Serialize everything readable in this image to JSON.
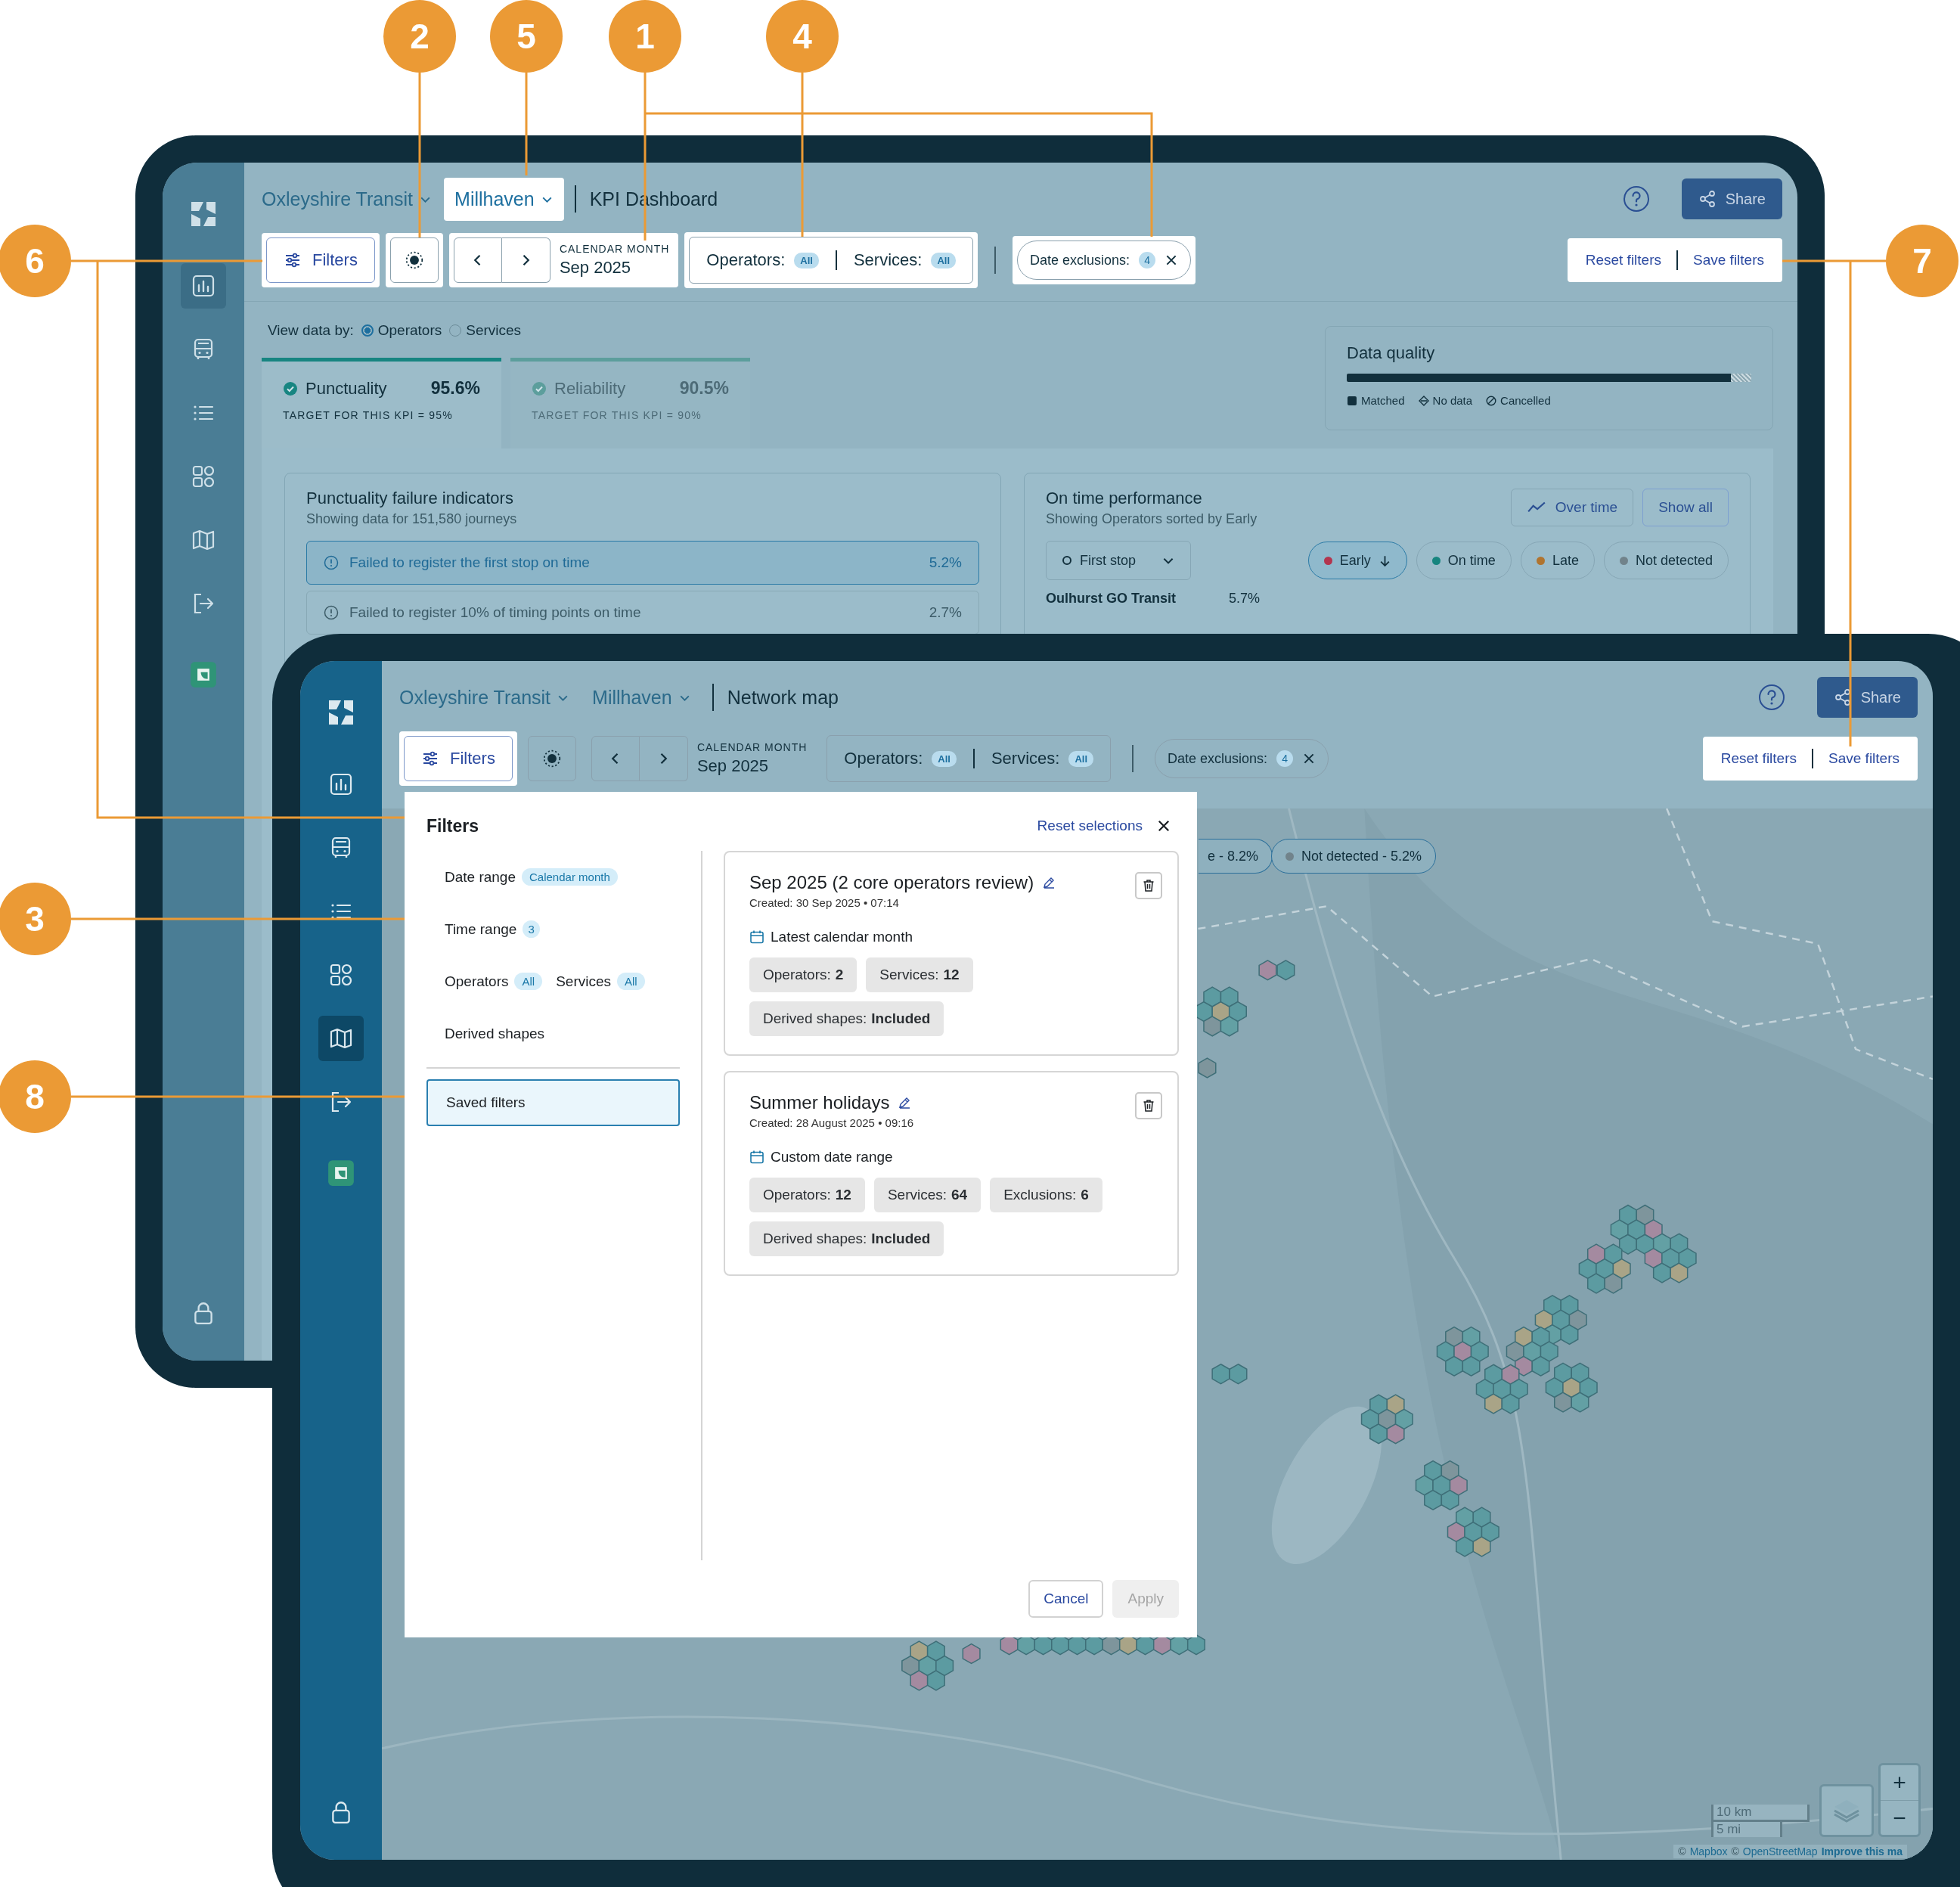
{
  "callouts": [
    {
      "number": "2"
    },
    {
      "number": "5"
    },
    {
      "number": "1"
    },
    {
      "number": "4"
    },
    {
      "number": "6"
    },
    {
      "number": "7"
    },
    {
      "number": "3"
    },
    {
      "number": "8"
    }
  ],
  "kpi_dashboard": {
    "sidebar": [
      {
        "kind": "chart",
        "selected": true
      },
      {
        "kind": "bus",
        "selected": false
      },
      {
        "kind": "list",
        "selected": false
      },
      {
        "kind": "apps",
        "selected": false
      },
      {
        "kind": "map",
        "selected": false
      },
      {
        "kind": "exit",
        "selected": false
      },
      {
        "kind": "tile",
        "selected": false
      }
    ],
    "breadcrumb": {
      "organisation": "Oxleyshire Transit",
      "area": {
        "label": "Millhaven",
        "highlighted": true
      },
      "page": "KPI Dashboard"
    },
    "share": "Share",
    "toolbar": {
      "filters": {
        "label": "Filters",
        "highlighted": true
      },
      "theme": {
        "highlighted": true
      },
      "period": {
        "label": "CALENDAR MONTH",
        "value": "Sep 2025",
        "highlighted": true
      },
      "scope": {
        "operators_label": "Operators:",
        "operators_badge": "All",
        "services_label": "Services:",
        "services_badge": "All",
        "highlighted": true
      },
      "exclusions": {
        "label": "Date exclusions:",
        "count": "4",
        "highlighted": true
      },
      "saved": {
        "reset": "Reset filters",
        "save": "Save filters",
        "highlighted": true
      }
    },
    "view_by": {
      "label": "View data by:",
      "options": [
        {
          "label": "Operators",
          "selected": true
        },
        {
          "label": "Services",
          "selected": false
        }
      ]
    },
    "kpi_tabs": [
      {
        "label": "Punctuality",
        "value": "95.6%",
        "target": "TARGET FOR THIS KPI = 95%",
        "selected": true
      },
      {
        "label": "Reliability",
        "value": "90.5%",
        "target": "TARGET FOR THIS KPI = 90%",
        "selected": false
      }
    ],
    "data_quality": {
      "title": "Data quality",
      "level": 0.95,
      "legend": [
        {
          "kind": "matched",
          "label": "Matched"
        },
        {
          "kind": "no_data",
          "label": "No data"
        },
        {
          "kind": "cancelled",
          "label": "Cancelled"
        }
      ]
    },
    "failure_indicators": {
      "title": "Punctuality failure indicators",
      "subtitle": "Showing data for 151,580 journeys",
      "rows": [
        {
          "label": "Failed to register the first stop on time",
          "value": "5.2%",
          "selected": true
        },
        {
          "label": "Failed to register 10% of timing points on time",
          "value": "2.7%",
          "selected": false
        }
      ]
    },
    "on_time_performance": {
      "title": "On time performance",
      "subtitle": "Showing Operators sorted by Early",
      "buttons": [
        {
          "kind": "trend",
          "label": "Over time"
        },
        {
          "kind": "plain",
          "label": "Show all"
        }
      ],
      "stop_select": "First stop",
      "categories": [
        {
          "label": "Early",
          "color": "#b3354e",
          "selected": true
        },
        {
          "label": "On time",
          "color": "#17857f",
          "selected": false
        },
        {
          "label": "Late",
          "color": "#b0742f",
          "selected": false
        },
        {
          "label": "Not detected",
          "color": "#71838b",
          "selected": false
        }
      ],
      "rows": [
        {
          "name": "Oulhurst GO Transit",
          "value": "5.7%"
        }
      ]
    }
  },
  "network_map": {
    "sidebar": [
      {
        "kind": "chart",
        "selected": false
      },
      {
        "kind": "bus",
        "selected": false
      },
      {
        "kind": "list",
        "selected": false
      },
      {
        "kind": "apps",
        "selected": false
      },
      {
        "kind": "map",
        "selected": true
      },
      {
        "kind": "exit",
        "selected": false
      },
      {
        "kind": "tile",
        "selected": false
      }
    ],
    "breadcrumb": {
      "organisation": "Oxleyshire Transit",
      "area": {
        "label": "Millhaven",
        "highlighted": false
      },
      "page": "Network map"
    },
    "share": "Share",
    "toolbar": {
      "filters": {
        "label": "Filters",
        "highlighted": true
      },
      "theme": {
        "highlighted": false
      },
      "period": {
        "label": "CALENDAR MONTH",
        "value": "Sep 2025",
        "highlighted": false
      },
      "scope": {
        "operators_label": "Operators:",
        "operators_badge": "All",
        "services_label": "Services:",
        "services_badge": "All",
        "highlighted": false
      },
      "exclusions": {
        "label": "Date exclusions:",
        "count": "4",
        "highlighted": false
      },
      "saved": {
        "reset": "Reset filters",
        "save": "Save filters",
        "highlighted": true
      }
    },
    "map": {
      "chips": [
        {
          "label": "e - 8.2%"
        },
        {
          "label": "Not detected - 5.2%",
          "color": "#71838b"
        }
      ],
      "scale": [
        "10 km",
        "5 mi"
      ],
      "zoom_in": "+",
      "zoom_out": "−",
      "attribution": [
        {
          "kind": "text",
          "text": "©"
        },
        {
          "kind": "link",
          "text": "Mapbox"
        },
        {
          "kind": "text",
          "text": "©"
        },
        {
          "kind": "link",
          "text": "OpenStreetMap"
        },
        {
          "kind": "strong",
          "text": "Improve this ma"
        }
      ]
    }
  },
  "filters_panel": {
    "title": "Filters",
    "reset": "Reset selections",
    "sections": [
      {
        "items": [
          {
            "label": "Date range",
            "badge": "Calendar month",
            "selected": false
          }
        ]
      },
      {
        "items": [
          {
            "label": "Time range",
            "badge": "3",
            "selected": false
          }
        ]
      },
      {
        "items": [
          {
            "label": "Operators",
            "badge": "All",
            "selected": false
          },
          {
            "label": "Services",
            "badge": "All",
            "selected": false
          }
        ]
      },
      {
        "items": [
          {
            "label": "Derived shapes",
            "selected": false
          }
        ]
      }
    ],
    "saved_item": {
      "label": "Saved filters",
      "selected": true
    },
    "saved_filters": [
      {
        "name": "Sep 2025 (2 core operators review)",
        "created": "Created: 30 Sep 2025 • 07:14",
        "date_mode": "Latest calendar month",
        "tags": [
          {
            "label": "Operators:",
            "value": "2"
          },
          {
            "label": "Services:",
            "value": "12"
          },
          {
            "label": "Derived shapes:",
            "value": "Included"
          }
        ]
      },
      {
        "name": "Summer holidays",
        "created": "Created: 28 August 2025 • 09:16",
        "date_mode": "Custom date range",
        "tags": [
          {
            "label": "Operators:",
            "value": "12"
          },
          {
            "label": "Services:",
            "value": "64"
          },
          {
            "label": "Exclusions:",
            "value": "6"
          },
          {
            "label": "Derived shapes:",
            "value": "Included"
          }
        ]
      }
    ],
    "cancel": "Cancel",
    "apply": {
      "label": "Apply",
      "disabled": true
    }
  }
}
